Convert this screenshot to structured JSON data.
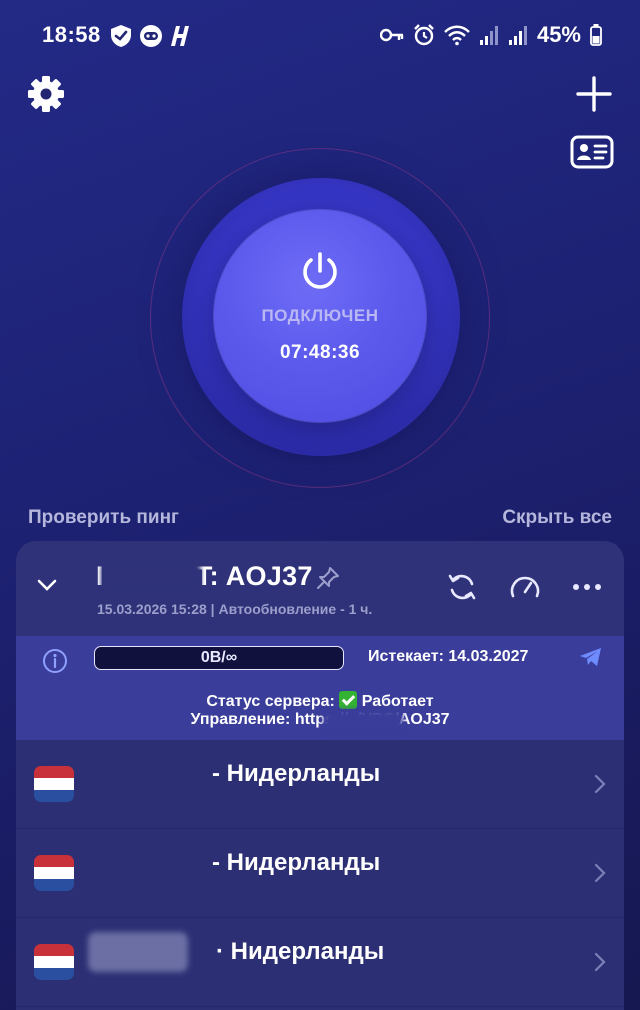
{
  "status_bar": {
    "time": "18:58",
    "battery": "45%",
    "left_icons": [
      "shield-icon",
      "robot-icon",
      "h-logo-icon"
    ],
    "right_icons": [
      "key-icon",
      "alarm-icon",
      "wifi-icon",
      "signal-icon",
      "signal-icon",
      "battery-icon"
    ]
  },
  "toolbar": {
    "settings_icon": "gear-icon",
    "add_icon": "plus-icon",
    "profile_icon": "id-card-icon"
  },
  "connection": {
    "status": "ПОДКЛЮЧЕН",
    "timer": "07:48:36",
    "connected": true
  },
  "actions": {
    "check_ping": "Проверить пинг",
    "hide_all": "Скрыть все"
  },
  "subscription": {
    "title": "T: AOJ37",
    "date_line": "15.03.2026 15:28 | Автообновление - 1 ч.",
    "traffic": "0B/∞",
    "expires": "Истекает: 14.03.2027",
    "server_status_label": "Статус сервера:",
    "server_status_value": "Работает",
    "management": "Управление: https://.                  /VDS/AOJ37"
  },
  "servers": [
    {
      "name": "- Нидерланды",
      "country": "NL"
    },
    {
      "name": "- Нидерланды",
      "country": "NL"
    },
    {
      "name": "· Нидерланды",
      "country": "NL"
    }
  ],
  "colors": {
    "background": "#1e2377",
    "accent": "#5c5aec",
    "panel": "#2c2f74",
    "info_band": "#3a3d9a",
    "success": "#34b233",
    "muted_text": "#b4b6dc"
  }
}
